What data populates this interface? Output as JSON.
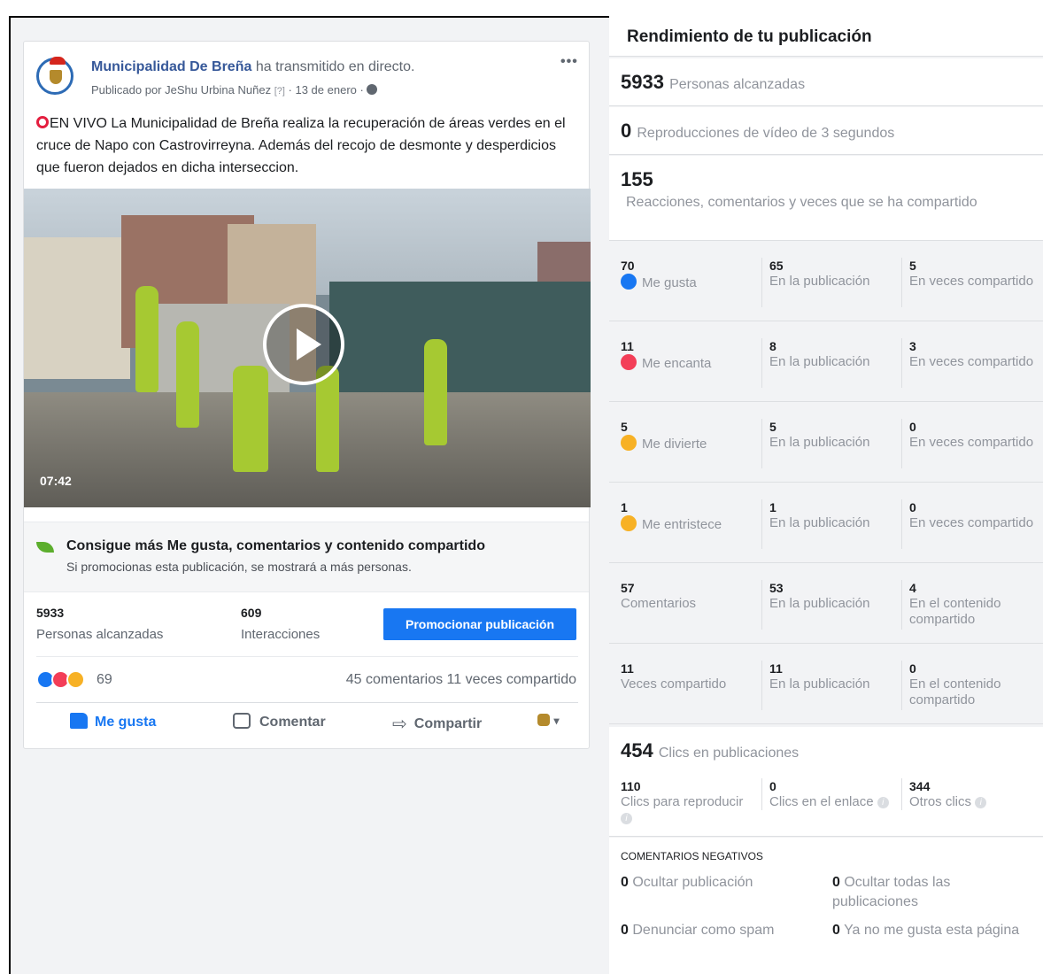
{
  "post": {
    "page_name": "Municipalidad De Breña",
    "action_text": " ha transmitido en directo.",
    "published_by": "Publicado por JeShu Urbina Nuñez",
    "help_mark": "[?]",
    "date": " · 13 de enero · ",
    "more": "•••",
    "text": "EN VIVO La Municipalidad de Breña realiza la recuperación de áreas verdes en el cruce de Napo con Castrovirreyna. Además del recojo de desmonte y desperdicios que fueron dejados en dicha interseccion.",
    "video_duration": "07:42"
  },
  "boost": {
    "title": "Consigue más Me gusta, comentarios y contenido compartido",
    "subtitle": "Si promocionas esta publicación, se mostrará a más personas."
  },
  "stats": {
    "reach_value": "5933",
    "reach_label": "Personas alcanzadas",
    "interactions_value": "609",
    "interactions_label": "Interacciones",
    "promote_button": "Promocionar publicación"
  },
  "reactions": {
    "count": "69",
    "comments_shares": "45 comentarios  11 veces compartido",
    "icons": [
      "like-icon",
      "love-icon",
      "haha-icon"
    ],
    "colors": {
      "like": "#1877f2",
      "love": "#f33e58",
      "haha": "#f7b125"
    }
  },
  "actions": {
    "like": "Me gusta",
    "comment": "Comentar",
    "share": "Compartir",
    "dropdown": "▾"
  },
  "performance": {
    "title": "Rendimiento de tu publicación",
    "reach_value": "5933",
    "reach_label": "Personas alcanzadas",
    "views_value": "0",
    "views_label": "Reproducciones de vídeo de 3 segundos",
    "engagement_value": "155",
    "engagement_label": "Reacciones, comentarios y veces que se ha compartido",
    "rows": [
      {
        "icon": "like-icon",
        "total": "70",
        "label": "Me gusta",
        "on_post": "65",
        "on_post_label": "En la publicación",
        "shares": "5",
        "shares_label": "En veces compartido"
      },
      {
        "icon": "love-icon",
        "total": "11",
        "label": "Me encanta",
        "on_post": "8",
        "on_post_label": "En la publicación",
        "shares": "3",
        "shares_label": "En veces compartido"
      },
      {
        "icon": "haha-icon",
        "total": "5",
        "label": "Me divierte",
        "on_post": "5",
        "on_post_label": "En la publicación",
        "shares": "0",
        "shares_label": "En veces compartido"
      },
      {
        "icon": "sad-icon",
        "total": "1",
        "label": "Me entristece",
        "on_post": "1",
        "on_post_label": "En la publicación",
        "shares": "0",
        "shares_label": "En veces compartido"
      },
      {
        "icon": "",
        "total": "57",
        "label": "Comentarios",
        "on_post": "53",
        "on_post_label": "En la publicación",
        "shares": "4",
        "shares_label": "En el contenido compartido"
      },
      {
        "icon": "",
        "total": "11",
        "label": "Veces compartido",
        "on_post": "11",
        "on_post_label": "En la publicación",
        "shares": "0",
        "shares_label": "En el contenido compartido"
      }
    ],
    "clicks_value": "454",
    "clicks_label": "Clics en publicaciones",
    "clicks": [
      {
        "value": "110",
        "label": "Clics para reproducir"
      },
      {
        "value": "0",
        "label": "Clics en el enlace"
      },
      {
        "value": "344",
        "label": "Otros clics"
      }
    ],
    "info_mark": "i",
    "negative_title": "COMENTARIOS NEGATIVOS",
    "negative": [
      {
        "value": "0",
        "label": "Ocultar publicación"
      },
      {
        "value": "0",
        "label": "Ocultar todas las publicaciones"
      },
      {
        "value": "0",
        "label": "Denunciar como spam"
      },
      {
        "value": "0",
        "label": "Ya no me gusta esta página"
      }
    ]
  }
}
